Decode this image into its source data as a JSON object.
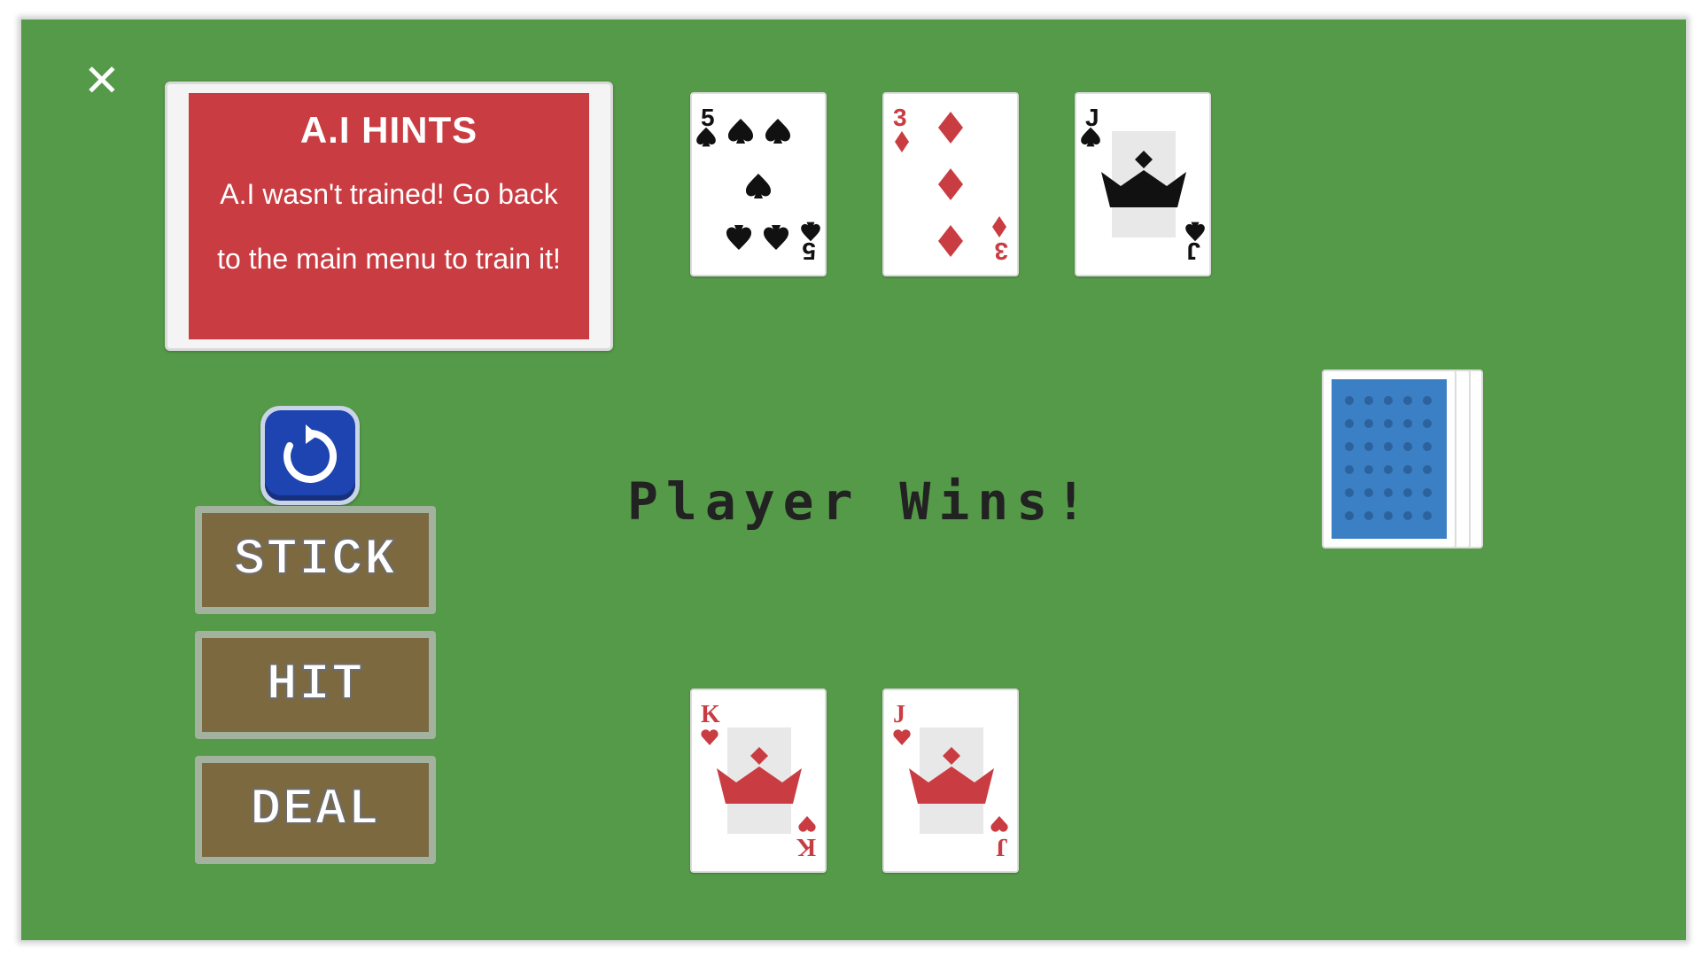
{
  "close_icon": "close-icon",
  "hints": {
    "title": "A.I HINTS",
    "line1": "A.I wasn't trained! Go back",
    "line2": "to the main menu to train it!"
  },
  "reset_icon": "restart-icon",
  "buttons": {
    "stick": "STICK",
    "hit": "HIT",
    "deal": "DEAL"
  },
  "result": "Player Wins!",
  "dealer_cards": [
    {
      "rank": "5",
      "suit": "spades",
      "color": "#111111"
    },
    {
      "rank": "3",
      "suit": "diamonds",
      "color": "#c93c42"
    },
    {
      "rank": "J",
      "suit": "spades",
      "color": "#111111"
    }
  ],
  "player_cards": [
    {
      "rank": "K",
      "suit": "hearts",
      "color": "#c93c42"
    },
    {
      "rank": "J",
      "suit": "hearts",
      "color": "#c93c42"
    }
  ],
  "deck_icon": "card-deck-back",
  "colors": {
    "felt": "#559a48",
    "hints_red": "#c93c42",
    "button_brown": "#7c6940",
    "deck_blue": "#3b7fc4"
  }
}
